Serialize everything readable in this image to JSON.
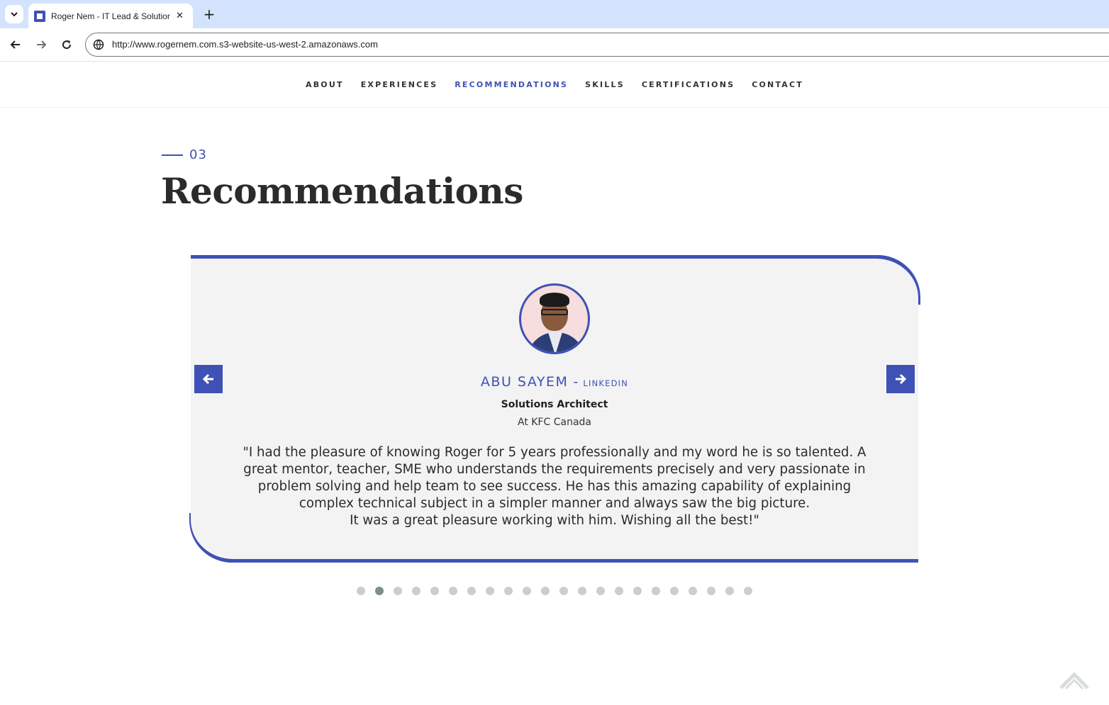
{
  "browser": {
    "tab_title": "Roger Nem - IT Lead & Solutions Architect",
    "tab_close": "✕",
    "new_tab": "+",
    "url": "http://www.rogernem.com.s3-website-us-west-2.amazonaws.com"
  },
  "nav": {
    "items": [
      {
        "label": "ABOUT"
      },
      {
        "label": "EXPERIENCES"
      },
      {
        "label": "RECOMMENDATIONS"
      },
      {
        "label": "SKILLS"
      },
      {
        "label": "CERTIFICATIONS"
      },
      {
        "label": "CONTACT"
      }
    ],
    "active": "RECOMMENDATIONS"
  },
  "section": {
    "number": "03",
    "title": "Recommendations"
  },
  "testimonial": {
    "name": "ABU SAYEM",
    "separator": "-",
    "link_label": "LINKEDIN",
    "role": "Solutions Architect",
    "company": "At KFC Canada",
    "quote_lines": [
      "\"I had the pleasure of knowing Roger for 5 years professionally and my word he is so talented. A",
      "great mentor, teacher, SME who understands the requirements precisely and very passionate in",
      "problem solving and help team to see success. He has this amazing capability of explaining",
      "complex technical subject in a simpler manner and always saw the big picture.",
      "It was a great pleasure working with him. Wishing all the best!\""
    ]
  },
  "carousel": {
    "total_slides": 22,
    "active_index": 1
  },
  "colors": {
    "accent": "#3f51b5",
    "card_bg": "#f3f3f3",
    "dot": "#c9cfcb",
    "dot_active": "#7e8f86",
    "tabstrip": "#d3e3fd"
  },
  "icons": {
    "tab_menu": "chevron-down-icon",
    "back": "arrow-left-icon",
    "forward": "arrow-right-icon",
    "reload": "reload-icon",
    "site_info": "site-info-icon",
    "prev": "arrow-left-icon",
    "next": "arrow-right-icon",
    "scroll_top": "chevron-up-icon"
  }
}
